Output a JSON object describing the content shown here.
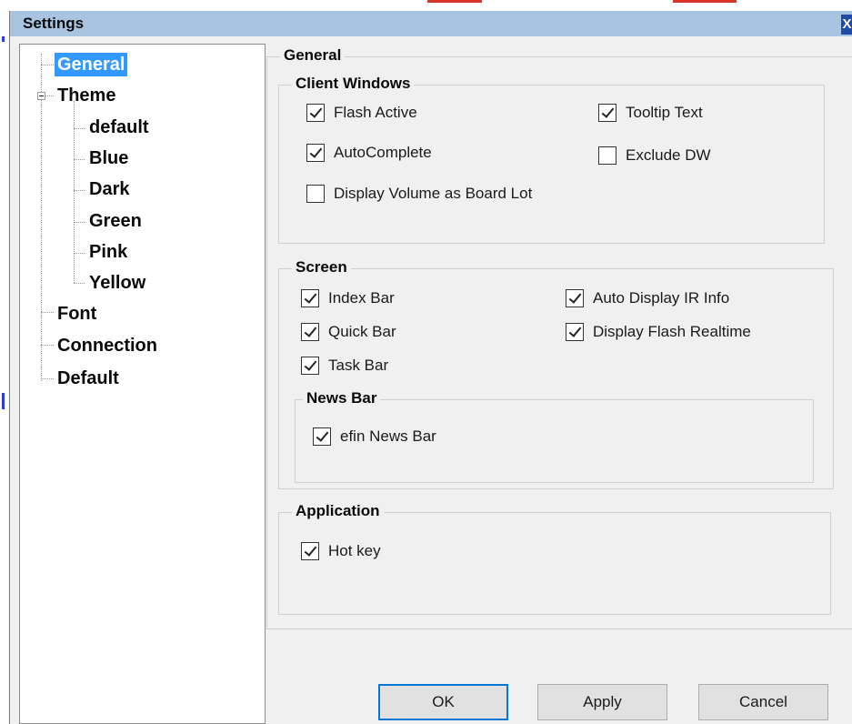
{
  "dialog": {
    "title": "Settings",
    "close_label": "X"
  },
  "tree": {
    "items": [
      {
        "label": "General",
        "selected": true
      },
      {
        "label": "Theme",
        "expanded": true
      },
      {
        "label": "default"
      },
      {
        "label": "Blue"
      },
      {
        "label": "Dark"
      },
      {
        "label": "Green"
      },
      {
        "label": "Pink"
      },
      {
        "label": "Yellow"
      },
      {
        "label": "Font"
      },
      {
        "label": "Connection"
      },
      {
        "label": "Default"
      }
    ]
  },
  "panel": {
    "title": "General",
    "client_windows": {
      "title": "Client Windows",
      "options": [
        {
          "label": "Flash Active",
          "checked": true
        },
        {
          "label": "Tooltip Text",
          "checked": true
        },
        {
          "label": "AutoComplete",
          "checked": true
        },
        {
          "label": "Exclude DW",
          "checked": false
        },
        {
          "label": "Display Volume as Board Lot",
          "checked": false
        }
      ]
    },
    "screen": {
      "title": "Screen",
      "options": [
        {
          "label": "Index Bar",
          "checked": true
        },
        {
          "label": "Auto Display IR Info",
          "checked": true
        },
        {
          "label": "Quick Bar",
          "checked": true
        },
        {
          "label": "Display Flash Realtime",
          "checked": true
        },
        {
          "label": "Task Bar",
          "checked": true
        }
      ],
      "news_bar": {
        "title": "News Bar",
        "options": [
          {
            "label": "efin News Bar",
            "checked": true
          }
        ]
      }
    },
    "application": {
      "title": "Application",
      "options": [
        {
          "label": "Hot key",
          "checked": true
        }
      ]
    }
  },
  "buttons": {
    "ok": "OK",
    "apply": "Apply",
    "cancel": "Cancel"
  },
  "colors": {
    "titlebar": "#a9c4e0",
    "selection": "#3399ff",
    "default_button_border": "#0078d7"
  }
}
